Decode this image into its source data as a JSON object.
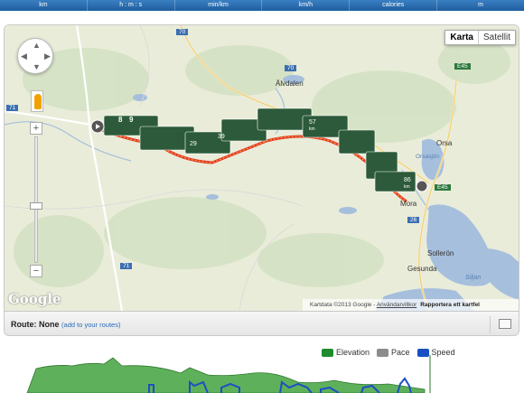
{
  "stats_header": [
    "km",
    "h : m : s",
    "min/km",
    "km/h",
    "calories",
    "m"
  ],
  "map": {
    "type_buttons": [
      "Karta",
      "Satellit"
    ],
    "active_type": "Karta",
    "places": [
      "Älvdalen",
      "Orsa",
      "Orsasjön",
      "Mora",
      "Sollerön",
      "Gesunda",
      "Siljan"
    ],
    "road_shields": [
      "70",
      "70",
      "71",
      "71",
      "E45",
      "E45",
      "26"
    ],
    "route_markers": [
      "8",
      "9",
      "29",
      "39",
      "57",
      "86"
    ],
    "marker_unit": "km",
    "google_logo": "Google",
    "attribution": "Kartdata ©2013 Google - ",
    "terms_link": "Användarvillkor",
    "report_link": "Rapportera ett kartfel"
  },
  "route_bar": {
    "label": "Route:",
    "value": "None",
    "add_link": "(add to your routes)"
  },
  "chart_legend": [
    {
      "name": "Elevation",
      "color": "#1e8c2e"
    },
    {
      "name": "Pace",
      "color": "#8c8c8c"
    },
    {
      "name": "Speed",
      "color": "#1a4fc4"
    }
  ]
}
